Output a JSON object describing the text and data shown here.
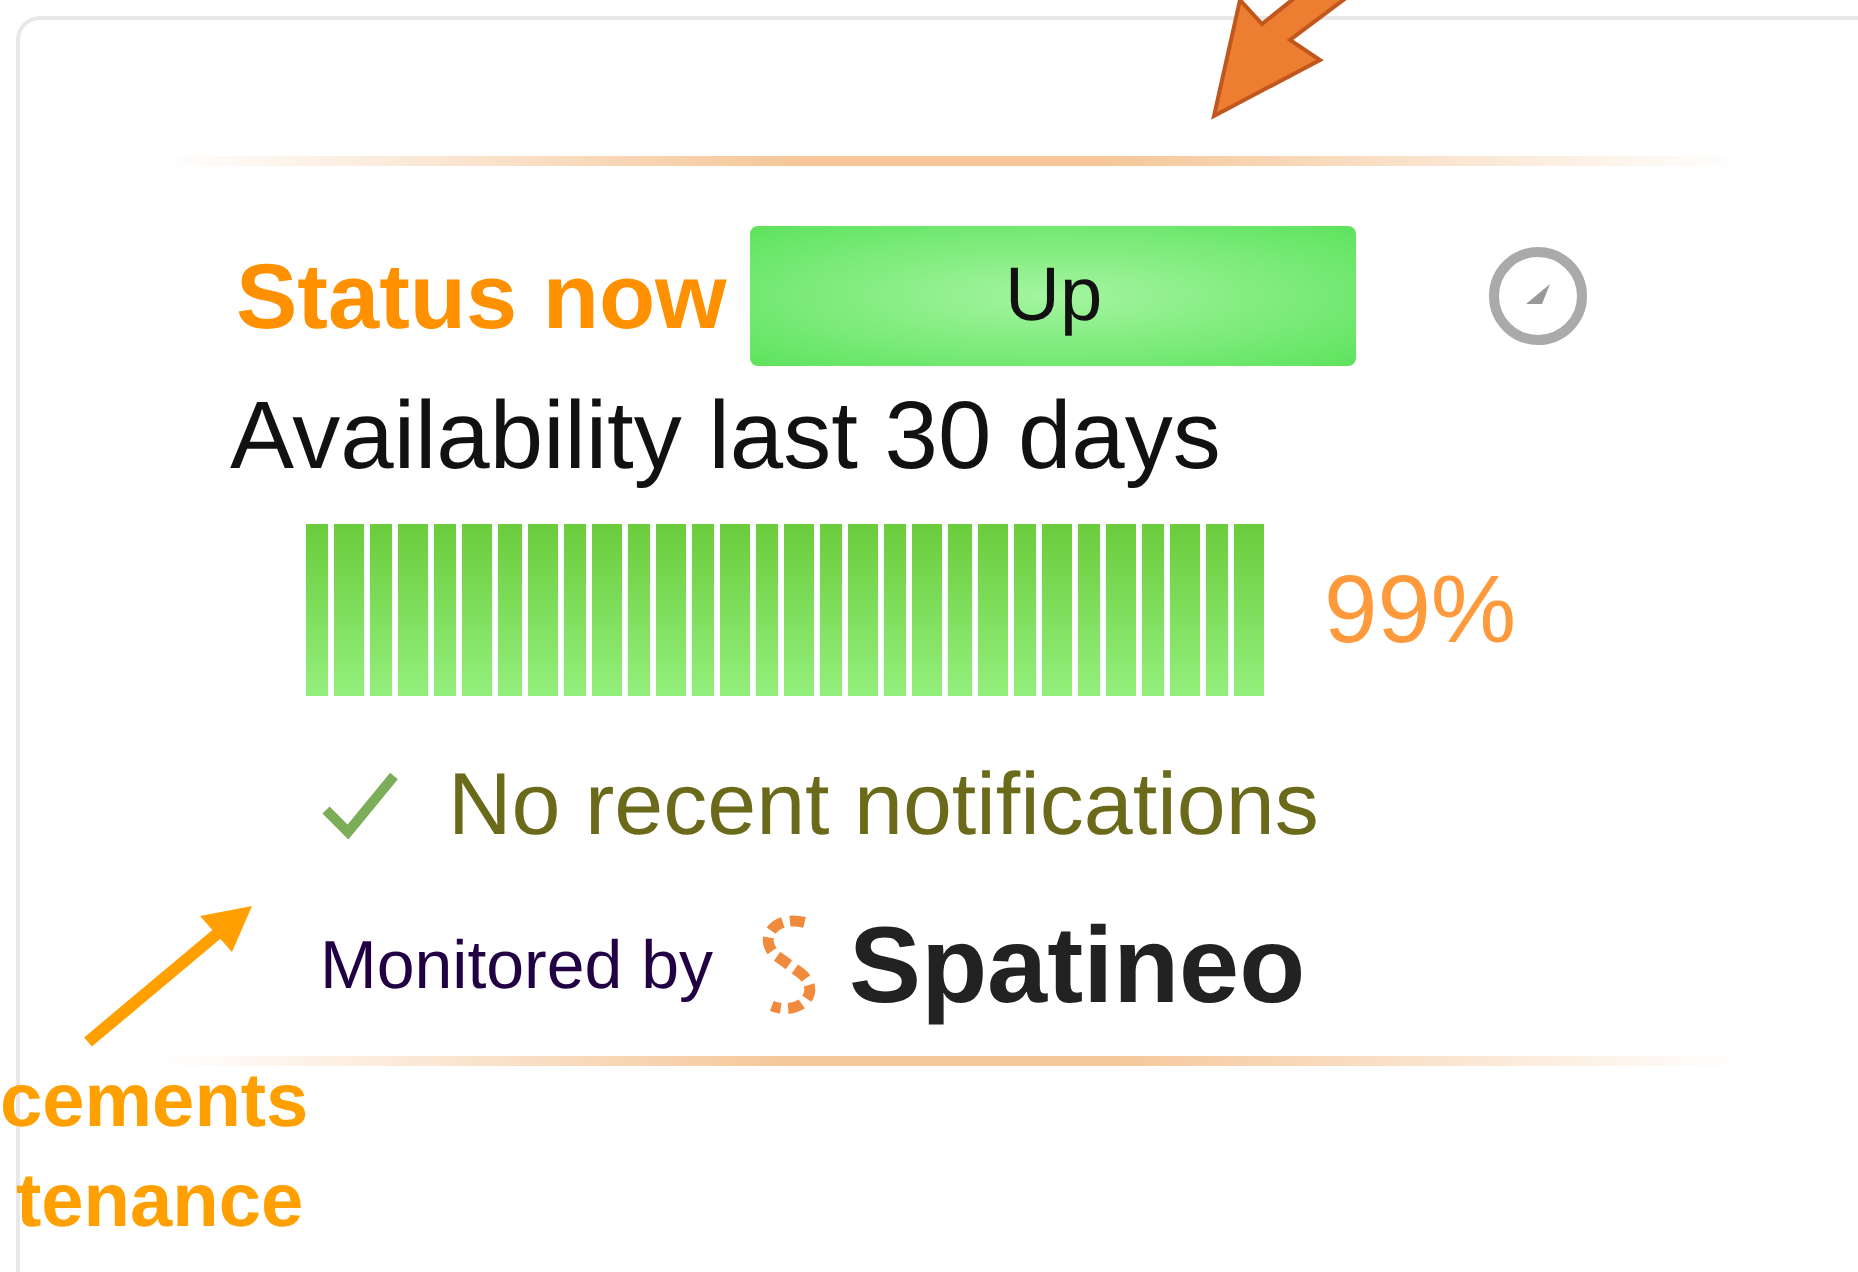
{
  "status": {
    "label": "Status now",
    "state": "Up",
    "kind": "up"
  },
  "availability": {
    "title": "Availability last 30 days",
    "percent": "99%",
    "days": [
      {
        "up": true
      },
      {
        "up": true
      },
      {
        "up": true
      },
      {
        "up": true
      },
      {
        "up": true
      },
      {
        "up": true
      },
      {
        "up": true
      },
      {
        "up": true
      },
      {
        "up": true
      },
      {
        "up": true
      },
      {
        "up": true
      },
      {
        "up": true
      },
      {
        "up": true
      },
      {
        "up": true
      },
      {
        "up": true
      },
      {
        "up": true
      },
      {
        "up": true
      },
      {
        "up": true
      },
      {
        "up": true
      },
      {
        "up": true
      },
      {
        "up": true
      },
      {
        "up": true
      },
      {
        "up": true
      },
      {
        "up": true
      },
      {
        "up": true
      },
      {
        "up": true
      },
      {
        "up": true
      },
      {
        "up": true
      },
      {
        "up": true
      },
      {
        "up": true
      }
    ]
  },
  "notifications": "No recent notifications",
  "footer": {
    "label": "Monitored by",
    "brand": "Spatineo"
  },
  "annotation": {
    "lines": [
      "cements",
      "tenance"
    ]
  }
}
